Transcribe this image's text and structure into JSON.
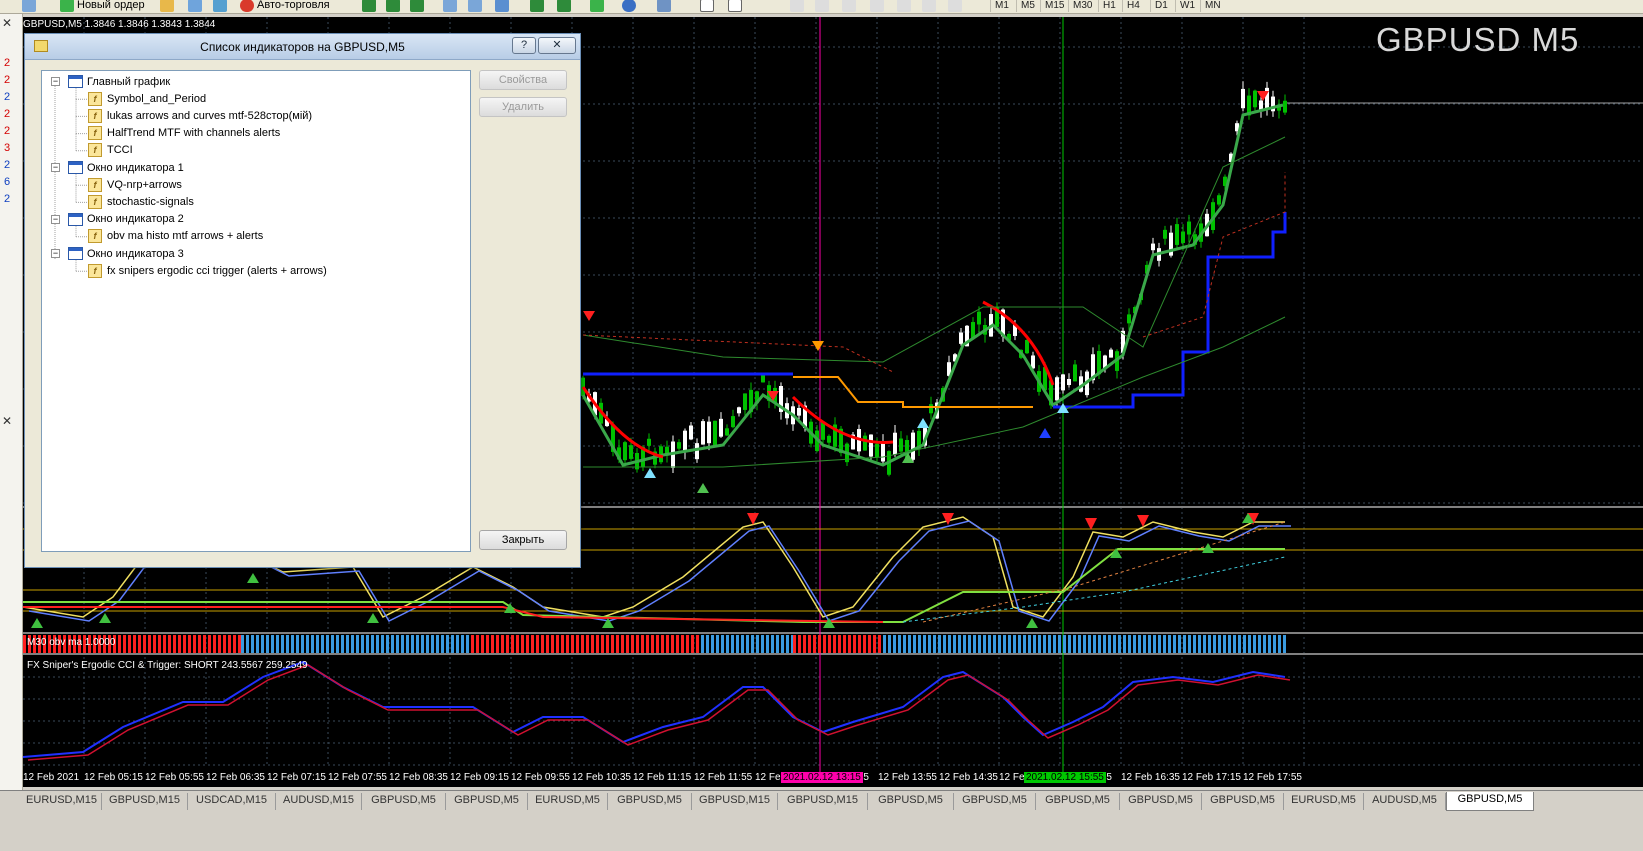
{
  "toolbar": {
    "new_order": "Новый ордер",
    "autotrading": "Авто-торговля",
    "timeframes": [
      "M1",
      "M5",
      "M15",
      "M30",
      "H1",
      "H4",
      "D1",
      "W1",
      "MN"
    ]
  },
  "side_numbers": [
    "2",
    "2",
    "2",
    "2",
    "2",
    "3",
    "2",
    "6",
    "2"
  ],
  "chart": {
    "header": "GBPUSD,M5  1.3846 1.3846 1.3843 1.3844",
    "symbol_watermark": "GBPUSD M5",
    "obv_label": "M30 obv ma 1.0000",
    "cci_label": "FX Sniper's Ergodic CCI & Trigger: SHORT 243.5567 259.2549",
    "time_labels": [
      "12 Feb 2021",
      "12 Feb 05:15",
      "12 Feb 05:55",
      "12 Feb 06:35",
      "12 Feb 07:15",
      "12 Feb 07:55",
      "12 Feb 08:35",
      "12 Feb 09:15",
      "12 Feb 09:55",
      "12 Feb 10:35",
      "12 Feb 11:15",
      "12 Feb 11:55",
      "12 Fe",
      ":15",
      "12 Feb 13:55",
      "12 Feb 14:35",
      "12 Fe",
      ":55",
      "12 Feb 16:35",
      "12 Feb 17:15",
      "12 Feb 17:55"
    ],
    "highlight_1": "2021.02.12 13:15",
    "highlight_2": "2021.02.12 15:55",
    "colors": {
      "bg": "#000000",
      "grid": "#3a4a5a",
      "bull": "#ffffff",
      "bear": "#00c000",
      "highlight_1": "#ff00aa",
      "highlight_2": "#00c800"
    }
  },
  "dialog": {
    "title": "Список индикаторов на GBPUSD,M5",
    "help_label": "?",
    "close_x": "✕",
    "tree": [
      {
        "level": 0,
        "label": "Главный график"
      },
      {
        "level": 1,
        "label": "Symbol_and_Period"
      },
      {
        "level": 1,
        "label": "lukas arrows and curves mtf-528стор(мій)"
      },
      {
        "level": 1,
        "label": "HalfTrend MTF with channels alerts"
      },
      {
        "level": 1,
        "label": "TCCI"
      },
      {
        "level": 0,
        "label": "Окно индикатора 1"
      },
      {
        "level": 1,
        "label": "VQ-nrp+arrows"
      },
      {
        "level": 1,
        "label": "stochastic-signals"
      },
      {
        "level": 0,
        "label": "Окно индикатора 2"
      },
      {
        "level": 1,
        "label": "obv ma histo mtf arrows + alerts"
      },
      {
        "level": 0,
        "label": "Окно индикатора 3"
      },
      {
        "level": 1,
        "label": "fx snipers ergodic cci trigger (alerts + arrows)"
      }
    ],
    "buttons": {
      "properties": "Свойства",
      "delete": "Удалить",
      "close": "Закрыть"
    }
  },
  "tabs": [
    "EURUSD,M15",
    "GBPUSD,M15",
    "USDCAD,M15",
    "AUDUSD,M15",
    "GBPUSD,M5",
    "GBPUSD,M5",
    "EURUSD,M5",
    "GBPUSD,M5",
    "GBPUSD,M15",
    "GBPUSD,M15",
    "GBPUSD,M5",
    "GBPUSD,M5",
    "GBPUSD,M5",
    "GBPUSD,M5",
    "GBPUSD,M5",
    "EURUSD,M5",
    "AUDUSD,M5",
    "GBPUSD,M5"
  ],
  "active_tab": 17
}
